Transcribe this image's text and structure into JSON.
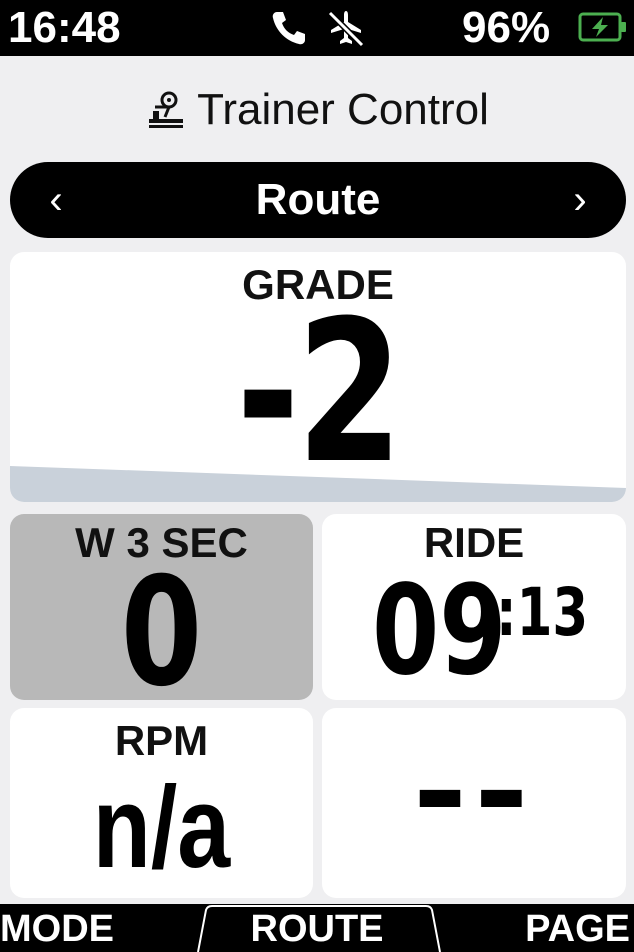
{
  "status": {
    "time": "16:48",
    "battery_percent": "96%",
    "icons": [
      "phone-icon",
      "airplane-mode-off-icon",
      "battery-charging-icon"
    ],
    "battery_color": "#4caf50"
  },
  "header": {
    "title": "Trainer Control",
    "icon": "bike-trainer-icon"
  },
  "mode_selector": {
    "label": "Route",
    "prev_glyph": "‹",
    "next_glyph": "›"
  },
  "fields": {
    "grade": {
      "label": "GRADE",
      "value": "-2"
    },
    "power": {
      "label": "W 3 SEC",
      "value": "0"
    },
    "ride": {
      "label": "RIDE",
      "value_main": "09",
      "value_sup": ":13"
    },
    "rpm": {
      "label": "RPM",
      "value": "n/a"
    },
    "empty": {
      "value": "--"
    }
  },
  "bottom_bar": {
    "left": "MODE",
    "center": "ROUTE",
    "right": "PAGE"
  },
  "colors": {
    "background": "#efeff1",
    "card": "#ffffff",
    "highlight_card": "#b8b8b8",
    "grade_profile": "#c9d1da"
  }
}
